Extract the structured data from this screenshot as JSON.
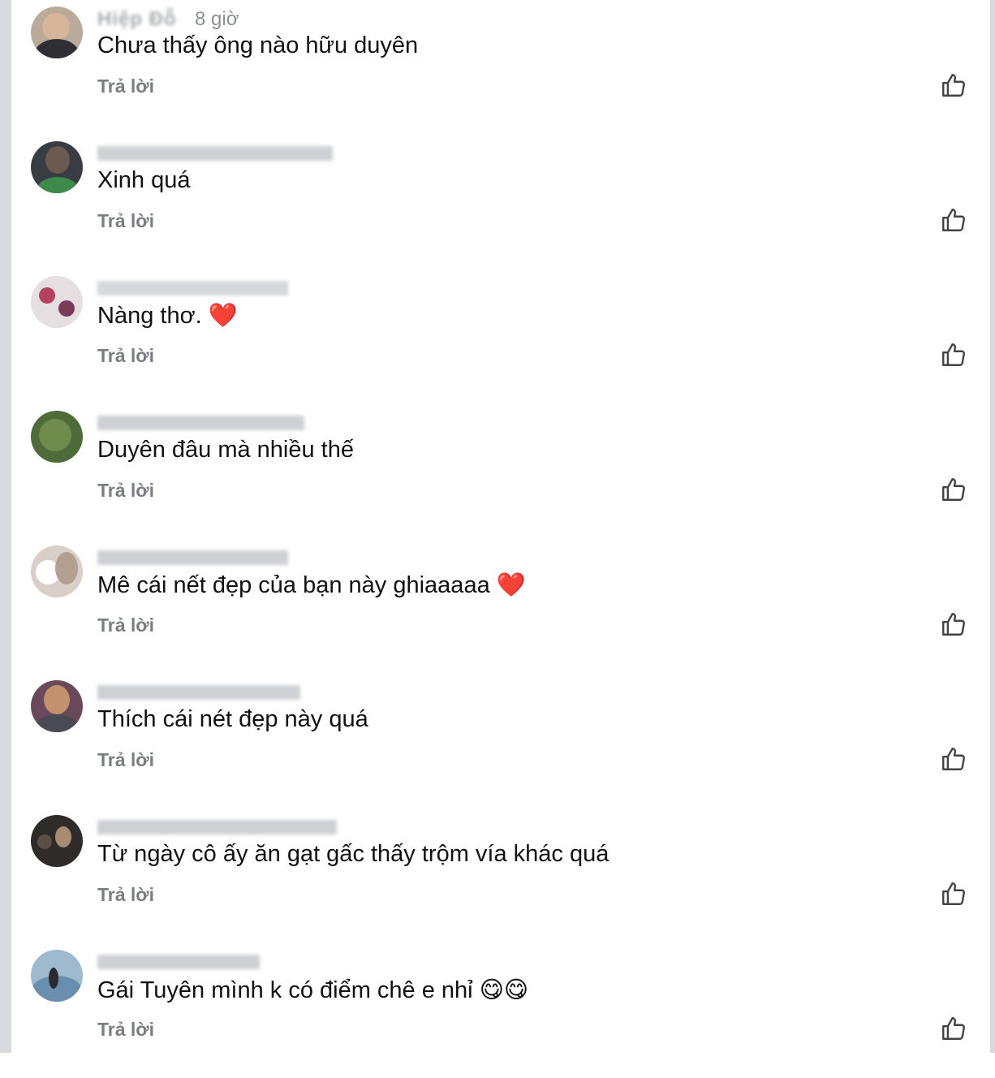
{
  "reply_label": "Trả lời",
  "comments": [
    {
      "name": "Hiệp Đỗ",
      "time": "8 giờ",
      "text": "Chưa thấy ông nào hữu duyên",
      "emoji": ""
    },
    {
      "name": "",
      "time": "",
      "text": "Xinh quá",
      "emoji": ""
    },
    {
      "name": "",
      "time": "",
      "text": "Nàng thơ.",
      "emoji": "❤️"
    },
    {
      "name": "",
      "time": "",
      "text": "Duyên đâu mà nhiều thế",
      "emoji": ""
    },
    {
      "name": "",
      "time": "",
      "text": "Mê cái nết đẹp của bạn này ghiaaaaa",
      "emoji": "❤️"
    },
    {
      "name": "",
      "time": "",
      "text": "Thích cái nét đẹp này quá",
      "emoji": ""
    },
    {
      "name": "",
      "time": "",
      "text": "Từ ngày cô ấy ăn gạt gấc thấy trộm vía khác quá",
      "emoji": ""
    },
    {
      "name": "",
      "time": "",
      "text": "Gái Tuyên mình k có điểm chê e nhỉ",
      "emoji": "😋😋"
    }
  ],
  "icons": {
    "like": "thumbs-up-icon",
    "avatar": "avatar"
  },
  "colors": {
    "text": "#111111",
    "muted": "#7a7d81",
    "edge": "#d9dadd"
  }
}
